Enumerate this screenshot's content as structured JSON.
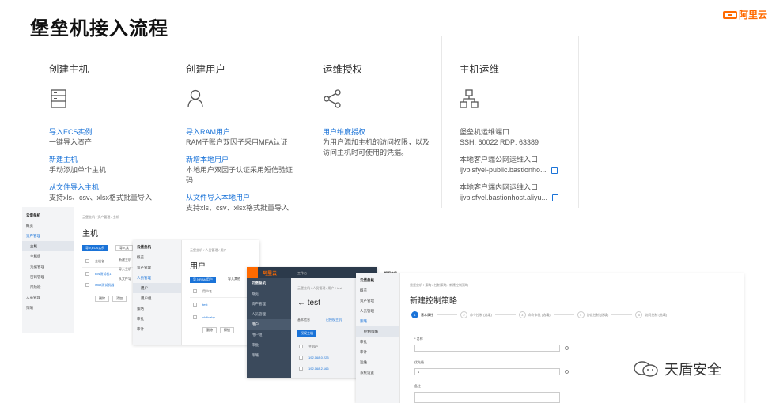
{
  "page_title": "堡垒机接入流程",
  "brand": "阿里云",
  "cards": [
    {
      "title": "创建主机",
      "icon": "server-icon",
      "entries": [
        {
          "link": "导入ECS实例",
          "text": "一键导入资产"
        },
        {
          "link": "新建主机",
          "text": "手动添加单个主机"
        },
        {
          "link": "从文件导入主机",
          "text": "支持xls、csv、xlsx格式批量导入"
        }
      ]
    },
    {
      "title": "创建用户",
      "icon": "user-icon",
      "entries": [
        {
          "link": "导入RAM用户",
          "text": "RAM子账户双因子采用MFA认证"
        },
        {
          "link": "新增本地用户",
          "text": "本地用户双因子认证采用短信验证码"
        },
        {
          "link": "从文件导入本地用户",
          "text": "支持xls、csv、xlsx格式批量导入"
        }
      ]
    },
    {
      "title": "运维授权",
      "icon": "share-icon",
      "entries": [
        {
          "link": "用户维度授权",
          "text": "为用户添加主机的访问权限，以及访问主机时可使用的凭据。"
        }
      ]
    },
    {
      "title": "主机运维",
      "icon": "network-icon",
      "lines": [
        "堡垒机运维端口",
        "SSH: 60022   RDP: 63389",
        "本地客户端公网运维入口",
        "ijvbisfyel-public.bastionho...",
        "本地客户端内网运维入口",
        "ijvbisfyel.bastionhost.aliyu..."
      ]
    }
  ],
  "shot1": {
    "side_title": "云堡垒机",
    "side_items": [
      "概览",
      "资产管理",
      "主机",
      "主机组",
      "凭据管理",
      "密码管理",
      "风险检",
      "人员管理",
      "策略"
    ],
    "crumb": "云堡垒机 / 资产管理 / 主机",
    "heading": "主机",
    "btn_import": "导入ECS实例",
    "btn_new": "导入其",
    "col_name": "主机名",
    "rows": [
      "ecs测试机1",
      "linux测试机器"
    ],
    "btn_a": "删除",
    "btn_b": "添加"
  },
  "shot2": {
    "side_title": "云堡垒机",
    "side_items": [
      "概览",
      "资产管理",
      "人员管理",
      "用户",
      "用户组",
      "策略",
      "审批",
      "审计"
    ],
    "crumb": "云堡垒机 / 人员管理 / 用户",
    "heading": "用户",
    "btn_import": "导入RAM用户",
    "btn_new": "导入其他",
    "col_name": "用户名",
    "rows": [
      "test",
      "ubiliuzhy"
    ],
    "btn_a": "删除",
    "btn_b": "解锁",
    "extra": [
      "新建主机",
      "导入主机",
      "从文件导"
    ]
  },
  "shot3": {
    "logo": "阿里云",
    "tab": "工作台",
    "side_title": "云堡垒机",
    "side_items": [
      "概览",
      "资产管理",
      "人员管理",
      "用户",
      "用户组",
      "审批",
      "策略"
    ],
    "crumb": "云堡垒机 / 人员管理 / 用户 / test",
    "heading": "← test",
    "tabs": [
      "基本信息",
      "已授权主机"
    ],
    "btn": "授权主机",
    "col": "主机IP",
    "rows": [
      "192.168.0.223",
      "192.168.2.166"
    ],
    "corner": "授权主机"
  },
  "shot4": {
    "side_title": "云堡垒机",
    "side_items": [
      "概览",
      "资产管理",
      "人员管理",
      "策略",
      "控制策略",
      "审批",
      "审计",
      "运维",
      "系统设置"
    ],
    "crumb": "云堡垒机 / 策略 / 控制策略 / 新建控制策略",
    "heading": "新建控制策略",
    "steps": [
      "基本属性",
      "命令控制 (选填)",
      "命令审批 (选填)",
      "协议控制 (选填)",
      "访问控制 (选填)"
    ],
    "label_name": "* 名称",
    "label_priority": "优先级",
    "priority_value": "1",
    "label_note": "备注"
  },
  "watermark": "天盾安全",
  "colors": {
    "accent": "#1a73d8",
    "brand": "#ff6a00"
  }
}
